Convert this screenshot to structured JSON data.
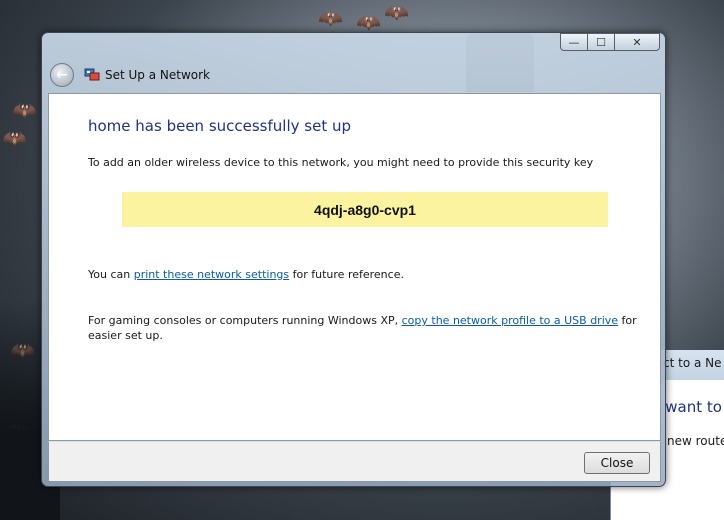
{
  "background_window": {
    "title": "ct to a Ne",
    "heading": "u want to",
    "text": "new router"
  },
  "dialog": {
    "title": "Set Up a Network",
    "controls": {
      "minimize": "—",
      "maximize": "☐",
      "close": "✕"
    },
    "heading": "home has been successfully set up",
    "intro": "To add an older wireless device to this network, you might need to provide this security key",
    "security_key": "4qdj-a8g0-cvp1",
    "print_prefix": "You can ",
    "print_link": "print these network settings",
    "print_suffix": " for future reference.",
    "xp_prefix": "For gaming consoles or computers running Windows XP, ",
    "xp_link": "copy the network profile to a USB drive",
    "xp_suffix": " for",
    "xp_line2": "easier set up.",
    "close_label": "Close"
  },
  "colors": {
    "heading": "#1e3287",
    "link": "#0b5cab",
    "key_background": "#fbf3a0"
  },
  "icons": [
    "back-arrow-icon",
    "network-setup-icon",
    "minimize-icon",
    "maximize-icon",
    "close-icon"
  ]
}
